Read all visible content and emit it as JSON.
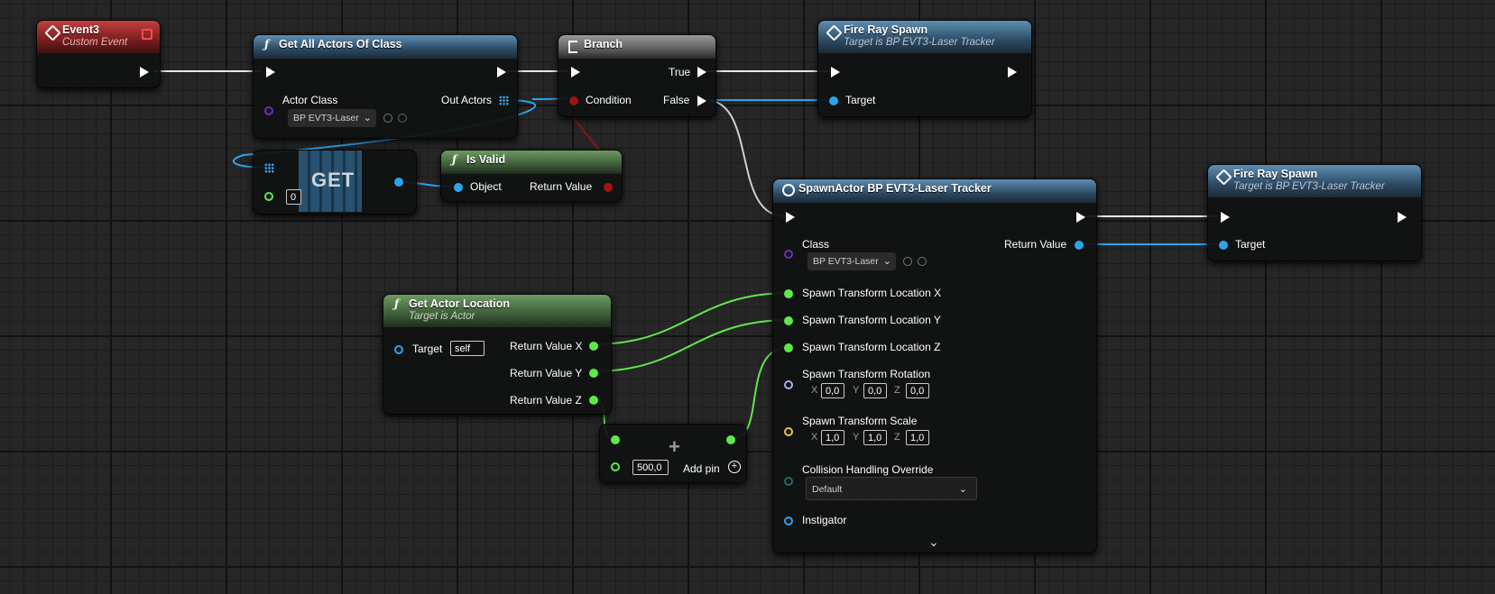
{
  "colors": {
    "exec": "#ffffff",
    "float": "#5fe84b",
    "object": "#2ba5ea",
    "class": "#6b2fbf",
    "bool": "#a01414",
    "rotator": "#9fb4e6",
    "vector_scale": "#e8c441",
    "enum": "#1c6b62"
  },
  "event3": {
    "title": "Event3",
    "subtitle": "Custom Event"
  },
  "get_all_actors": {
    "title": "Get All Actors Of Class",
    "actor_class_label": "Actor Class",
    "actor_class_value": "BP EVT3-Laser",
    "out_actors_label": "Out Actors"
  },
  "branch": {
    "title": "Branch",
    "true_label": "True",
    "false_label": "False",
    "condition_label": "Condition"
  },
  "fire_ray_1": {
    "title": "Fire Ray Spawn",
    "subtitle": "Target is BP EVT3-Laser Tracker",
    "target_label": "Target"
  },
  "get_node": {
    "label": "GET",
    "index_value": "0"
  },
  "is_valid": {
    "title": "Is Valid",
    "object_label": "Object",
    "return_label": "Return Value"
  },
  "spawn_actor": {
    "title": "SpawnActor BP EVT3-Laser Tracker",
    "class_label": "Class",
    "class_value": "BP EVT3-Laser",
    "return_label": "Return Value",
    "loc_x": "Spawn Transform Location X",
    "loc_y": "Spawn Transform Location Y",
    "loc_z": "Spawn Transform Location Z",
    "rotation_label": "Spawn Transform Rotation",
    "rotation": {
      "x": "0,0",
      "y": "0,0",
      "z": "0,0"
    },
    "scale_label": "Spawn Transform Scale",
    "scale": {
      "x": "1,0",
      "y": "1,0",
      "z": "1,0"
    },
    "axis_x": "X",
    "axis_y": "Y",
    "axis_z": "Z",
    "collision_label": "Collision Handling Override",
    "collision_value": "Default",
    "instigator_label": "Instigator"
  },
  "fire_ray_2": {
    "title": "Fire Ray Spawn",
    "subtitle": "Target is BP EVT3-Laser Tracker",
    "target_label": "Target"
  },
  "get_actor_location": {
    "title": "Get Actor Location",
    "subtitle": "Target is Actor",
    "target_label": "Target",
    "target_value": "self",
    "ret_x": "Return Value X",
    "ret_y": "Return Value Y",
    "ret_z": "Return Value Z"
  },
  "add_node": {
    "value": "500,0",
    "add_pin_label": "Add pin",
    "symbol": "+"
  }
}
